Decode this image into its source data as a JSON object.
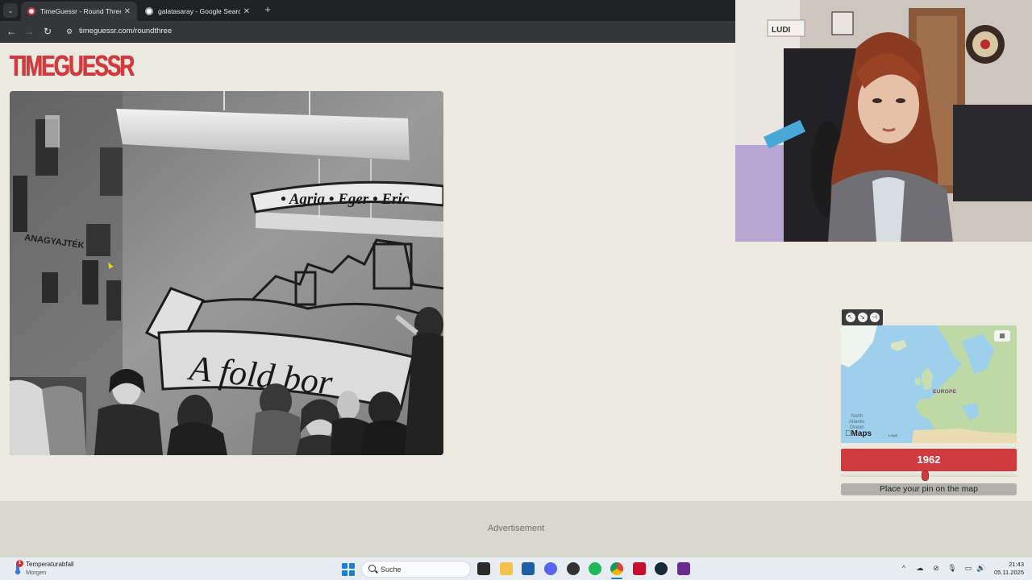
{
  "browser": {
    "tabs": [
      {
        "title": "TimeGuessr - Round Three",
        "active": true
      },
      {
        "title": "galatasaray - Google Search",
        "active": false
      }
    ],
    "new_tab": "+",
    "tab_close": "✕",
    "url": "timeguessr.com/roundthree"
  },
  "page": {
    "logo": "TIMEGUESSR",
    "photo_texts": {
      "banner": "• Agria • Eger • Eric",
      "scroll": "A fold bor"
    },
    "map": {
      "region_label": "EUROPE",
      "ocean_label": [
        "North",
        "Atlantic",
        "Ocean"
      ],
      "brand": "Maps",
      "legal": "Legal",
      "layer_icon": "map-layers-icon"
    },
    "year_guess": "1962",
    "year_slider_fraction": 0.48,
    "pin_button": "Place your pin on the map",
    "ad_label": "Advertisement"
  },
  "taskbar": {
    "weather_title": "Temperaturabfall",
    "weather_sub": "Morgen",
    "weather_badge": "1",
    "search_placeholder": "Suche",
    "time": "21:43",
    "date": "05.11.2025"
  },
  "colors": {
    "accent": "#cf3b3f",
    "page_bg": "#eceae0",
    "ad_bg": "#dad8cd",
    "pin_button_bg": "#b1b0ab"
  }
}
